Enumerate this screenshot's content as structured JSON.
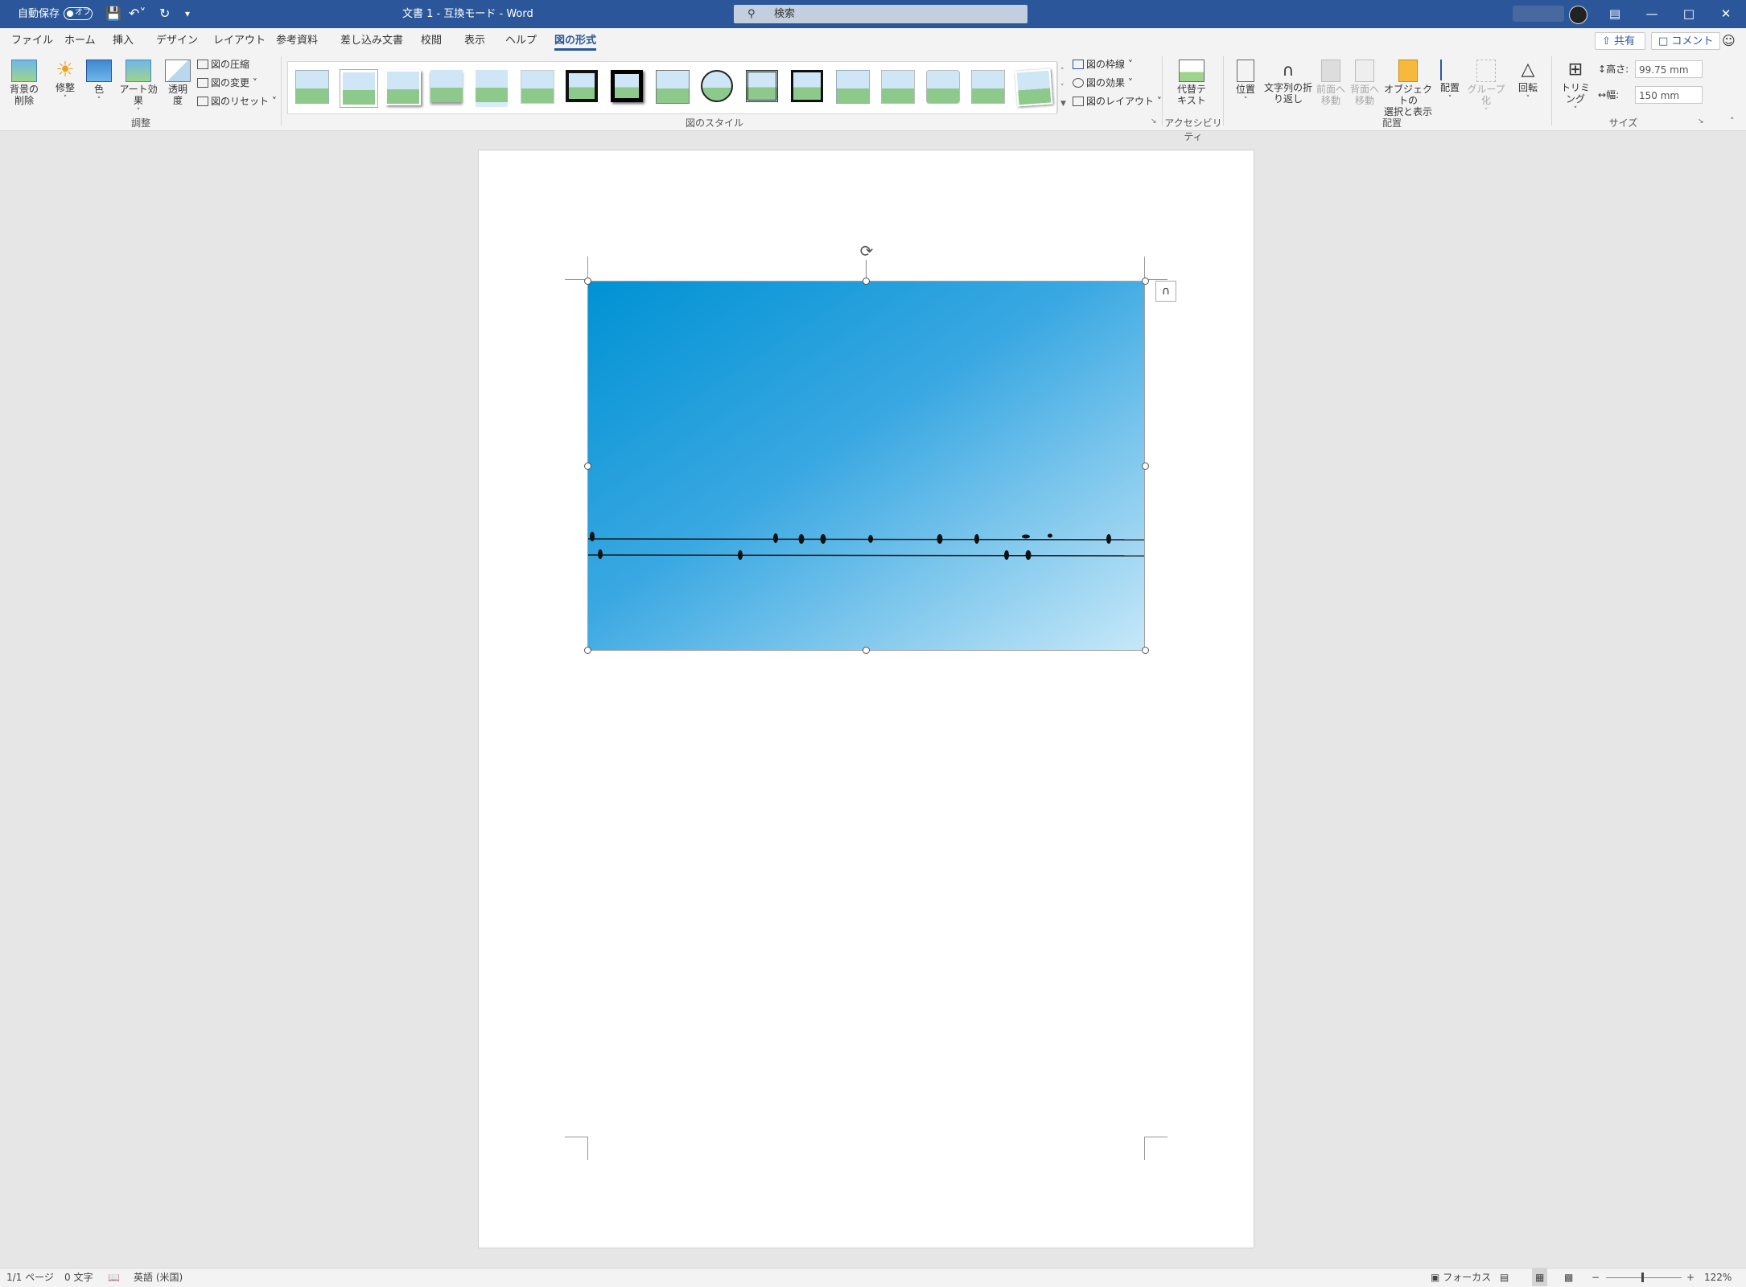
{
  "titlebar": {
    "autosave_label": "自動保存",
    "autosave_state": "オフ",
    "doc_title": "文書 1  -  互換モード  -  Word",
    "search_placeholder": "検索"
  },
  "tabs": [
    "ファイル",
    "ホーム",
    "挿入",
    "デザイン",
    "レイアウト",
    "参考資料",
    "差し込み文書",
    "校閲",
    "表示",
    "ヘルプ",
    "図の形式"
  ],
  "active_tab": "図の形式",
  "share_label": "共有",
  "comment_label": "コメント",
  "ribbon": {
    "adjust": {
      "remove_bg": "背景の\n削除",
      "corrections": "修整",
      "color": "色",
      "artistic": "アート効果",
      "transparency": "透明\n度",
      "compress": "図の圧縮",
      "change": "図の変更",
      "reset": "図のリセット",
      "group_label": "調整"
    },
    "styles": {
      "border": "図の枠線",
      "effects": "図の効果",
      "layout": "図のレイアウト",
      "group_label": "図のスタイル"
    },
    "accessibility": {
      "alt_text": "代替テ\nキスト",
      "group_label": "アクセシビリティ"
    },
    "arrange": {
      "position": "位置",
      "wrap": "文字列の折\nり返し",
      "forward": "前面へ\n移動",
      "backward": "背面へ\n移動",
      "selection": "オブジェクトの\n選択と表示",
      "align": "配置",
      "group": "グループ化",
      "rotate": "回転",
      "group_label": "配置"
    },
    "size": {
      "crop": "トリミング",
      "height_label": "高さ:",
      "height_value": "99.75 mm",
      "width_label": "幅:",
      "width_value": "150 mm",
      "group_label": "サイズ"
    }
  },
  "status": {
    "page": "1/1 ページ",
    "words": "0 文字",
    "language": "英語 (米国)",
    "focus": "フォーカス",
    "zoom": "122%"
  },
  "colors": {
    "accent": "#2b579a",
    "sky_top": "#0a96d8",
    "sky_bottom": "#bfe4f6"
  }
}
